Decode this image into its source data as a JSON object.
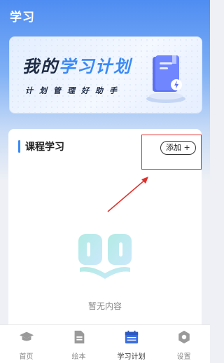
{
  "header": {
    "title": "学习"
  },
  "banner": {
    "title_part1": "我的",
    "title_part2": "学习计划",
    "subtitle": "计划管理好助手"
  },
  "course_section": {
    "title": "课程学习",
    "add_label": "添加 +",
    "empty_text": "暂无内容"
  },
  "tabbar": {
    "items": [
      {
        "label": "首页",
        "icon": "graduation-cap-icon"
      },
      {
        "label": "绘本",
        "icon": "document-icon"
      },
      {
        "label": "学习计划",
        "icon": "calendar-icon",
        "active": true
      },
      {
        "label": "设置",
        "icon": "gear-icon"
      }
    ]
  },
  "colors": {
    "accent": "#3a8af5",
    "highlight": "#e0302b",
    "header_blue": "#4f8df2"
  }
}
